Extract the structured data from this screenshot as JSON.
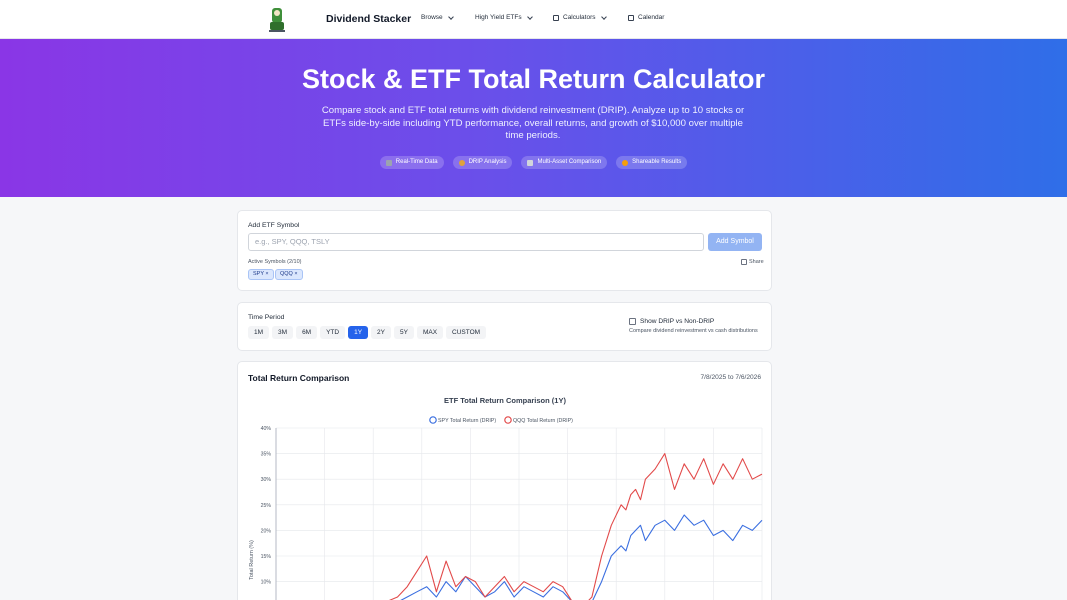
{
  "nav": {
    "brand": "Dividend Stacker",
    "items": [
      {
        "label": "Browse"
      },
      {
        "label": "High Yield ETFs"
      },
      {
        "label": "Calculators"
      },
      {
        "label": "Calendar"
      }
    ]
  },
  "hero": {
    "title": "Stock & ETF Total Return Calculator",
    "description": "Compare stock and ETF total returns with dividend reinvestment (DRIP). Analyze up to 10 stocks or ETFs side-by-side including YTD performance, overall returns, and growth of $10,000 over multiple time periods.",
    "badges": [
      {
        "label": "Real-Time Data",
        "icon": "chart-icon"
      },
      {
        "label": "DRIP Analysis",
        "icon": "money-bag-icon"
      },
      {
        "label": "Multi-Asset Comparison",
        "icon": "trend-icon"
      },
      {
        "label": "Shareable Results",
        "icon": "rocket-icon"
      }
    ]
  },
  "symbol_card": {
    "label": "Add ETF Symbol",
    "placeholder": "e.g., SPY, QQQ, TSLY",
    "add_button": "Add Symbol",
    "active_label": "Active Symbols (2/10)",
    "share": "Share",
    "symbols": [
      "SPY ×",
      "QQQ ×"
    ]
  },
  "period_card": {
    "label": "Time Period",
    "periods": [
      "1M",
      "3M",
      "6M",
      "YTD",
      "1Y",
      "2Y",
      "5Y",
      "MAX",
      "CUSTOM"
    ],
    "active": "1Y",
    "drip_toggle": "Show DRIP vs Non-DRIP",
    "drip_help": "Compare dividend reinvestment vs cash distributions"
  },
  "chart_card": {
    "heading": "Total Return Comparison",
    "range": "7/8/2025 to 7/6/2026"
  },
  "colors": {
    "spy": "#3b6fe0",
    "qqq": "#e24a4a",
    "accent": "#2563eb"
  },
  "chart_data": {
    "type": "line",
    "title": "ETF Total Return Comparison (1Y)",
    "ylabel": "Total Return (%)",
    "xlabel": "",
    "ylim": [
      0,
      40
    ],
    "yticks": [
      "10%",
      "15%",
      "20%",
      "25%",
      "30%",
      "35%",
      "40%"
    ],
    "grid": true,
    "legend": "top-center",
    "series": [
      {
        "name": "SPY Total Return (DRIP)",
        "color": "#3b6fe0",
        "x": [
          0.2,
          0.25,
          0.27,
          0.29,
          0.31,
          0.33,
          0.35,
          0.37,
          0.39,
          0.41,
          0.43,
          0.45,
          0.47,
          0.49,
          0.51,
          0.53,
          0.55,
          0.57,
          0.59,
          0.61,
          0.63,
          0.65,
          0.67,
          0.69,
          0.71,
          0.72,
          0.73,
          0.74,
          0.75,
          0.76,
          0.78,
          0.8,
          0.82,
          0.84,
          0.86,
          0.88,
          0.9,
          0.92,
          0.94,
          0.96,
          0.98,
          1.0
        ],
        "y": [
          5,
          6,
          7,
          8,
          9,
          7,
          10,
          8,
          11,
          9,
          7,
          8,
          10,
          7,
          9,
          8,
          7,
          9,
          8,
          6,
          5,
          6,
          10,
          15,
          17,
          16,
          19,
          20,
          21,
          18,
          21,
          22,
          20,
          23,
          21,
          22,
          19,
          20,
          18,
          21,
          20,
          22
        ]
      },
      {
        "name": "QQQ Total Return (DRIP)",
        "color": "#e24a4a",
        "x": [
          0.2,
          0.25,
          0.27,
          0.29,
          0.31,
          0.33,
          0.35,
          0.37,
          0.39,
          0.41,
          0.43,
          0.45,
          0.47,
          0.49,
          0.51,
          0.53,
          0.55,
          0.57,
          0.59,
          0.61,
          0.63,
          0.65,
          0.67,
          0.69,
          0.71,
          0.72,
          0.73,
          0.74,
          0.75,
          0.76,
          0.78,
          0.8,
          0.82,
          0.84,
          0.86,
          0.88,
          0.9,
          0.92,
          0.94,
          0.96,
          0.98,
          1.0
        ],
        "y": [
          5,
          7,
          9,
          12,
          15,
          8,
          14,
          9,
          11,
          10,
          7,
          9,
          11,
          8,
          10,
          9,
          8,
          10,
          9,
          6,
          5,
          7,
          15,
          21,
          25,
          24,
          27,
          28,
          26,
          30,
          32,
          35,
          28,
          33,
          30,
          34,
          29,
          33,
          30,
          34,
          30,
          31
        ]
      }
    ]
  }
}
